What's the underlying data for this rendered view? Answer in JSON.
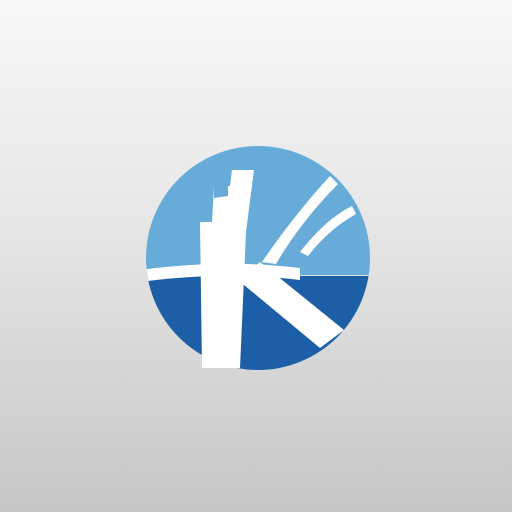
{
  "app_icon": {
    "icon": "k-circle-logo-icon",
    "colors": {
      "background_top": "#f8f8f8",
      "background_bottom": "#c6c6c6",
      "light_blue": "#67acd8",
      "dark_blue": "#1d5fa6",
      "white": "#ffffff"
    }
  }
}
